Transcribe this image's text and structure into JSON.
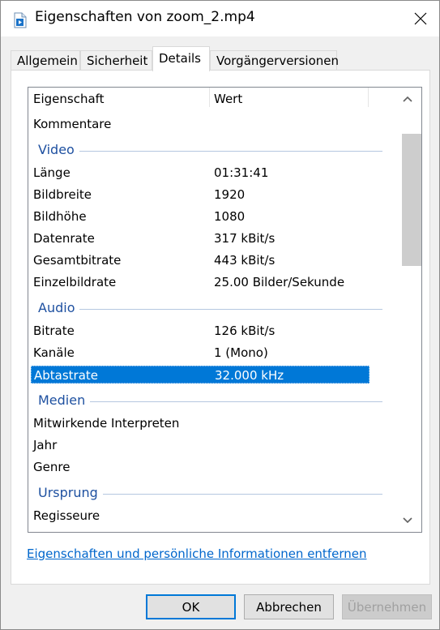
{
  "window": {
    "title": "Eigenschaften von zoom_2.mp4"
  },
  "tabs": [
    {
      "label": "Allgemein"
    },
    {
      "label": "Sicherheit"
    },
    {
      "label": "Details",
      "active": true
    },
    {
      "label": "Vorgängerversionen"
    }
  ],
  "list": {
    "columns": {
      "property": "Eigenschaft",
      "value": "Wert"
    },
    "rows": [
      {
        "kind": "row",
        "property": "Kommentare",
        "value": ""
      },
      {
        "kind": "group",
        "label": "Video"
      },
      {
        "kind": "row",
        "property": "Länge",
        "value": "01:31:41"
      },
      {
        "kind": "row",
        "property": "Bildbreite",
        "value": "1920"
      },
      {
        "kind": "row",
        "property": "Bildhöhe",
        "value": "1080"
      },
      {
        "kind": "row",
        "property": "Datenrate",
        "value": "317 kBit/s"
      },
      {
        "kind": "row",
        "property": "Gesamtbitrate",
        "value": "443 kBit/s"
      },
      {
        "kind": "row",
        "property": "Einzelbildrate",
        "value": "25.00 Bilder/Sekunde"
      },
      {
        "kind": "group",
        "label": "Audio"
      },
      {
        "kind": "row",
        "property": "Bitrate",
        "value": "126 kBit/s"
      },
      {
        "kind": "row",
        "property": "Kanäle",
        "value": "1 (Mono)"
      },
      {
        "kind": "row",
        "property": "Abtastrate",
        "value": "32.000 kHz",
        "selected": true
      },
      {
        "kind": "group",
        "label": "Medien"
      },
      {
        "kind": "row",
        "property": "Mitwirkende Interpreten",
        "value": ""
      },
      {
        "kind": "row",
        "property": "Jahr",
        "value": ""
      },
      {
        "kind": "row",
        "property": "Genre",
        "value": ""
      },
      {
        "kind": "group",
        "label": "Ursprung"
      },
      {
        "kind": "row",
        "property": "Regisseure",
        "value": ""
      }
    ]
  },
  "link": {
    "label": "Eigenschaften und persönliche Informationen entfernen"
  },
  "buttons": {
    "ok": "OK",
    "cancel": "Abbrechen",
    "apply": "Übernehmen"
  },
  "colors": {
    "selection": "#0078d7",
    "group_label": "#1e50a0",
    "link": "#0066cc"
  },
  "icons": {
    "file": "video-file-icon",
    "close": "close-icon",
    "scroll_up": "chevron-up-icon",
    "scroll_down": "chevron-down-icon"
  }
}
